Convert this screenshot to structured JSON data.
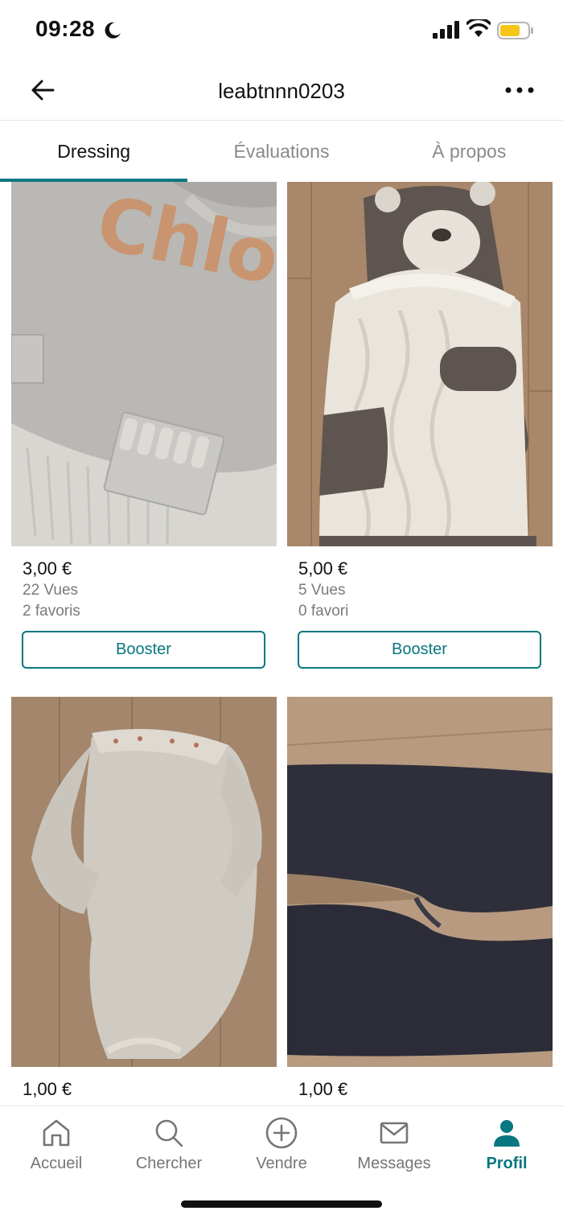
{
  "status": {
    "time": "09:28"
  },
  "header": {
    "title": "leabtnnn0203"
  },
  "tabs": [
    {
      "label": "Dressing"
    },
    {
      "label": "Évaluations"
    },
    {
      "label": "À propos"
    }
  ],
  "items": [
    {
      "photo": "grey-knit-sweater",
      "price": "3,00 €",
      "views": "22 Vues",
      "favorites": "2 favoris",
      "booster_label": "Booster"
    },
    {
      "photo": "bear-knit-sleeping-bag",
      "price": "5,00 €",
      "views": "5 Vues",
      "favorites": "0 favori",
      "booster_label": "Booster"
    },
    {
      "photo": "grey-bodysuit",
      "price": "1,00 €"
    },
    {
      "photo": "dark-leggings",
      "price": "1,00 €"
    }
  ],
  "bottom_nav": [
    {
      "label": "Accueil",
      "icon": "home-icon"
    },
    {
      "label": "Chercher",
      "icon": "search-icon"
    },
    {
      "label": "Vendre",
      "icon": "plus-circle-icon"
    },
    {
      "label": "Messages",
      "icon": "mail-icon"
    },
    {
      "label": "Profil",
      "icon": "profile-icon"
    }
  ],
  "colors": {
    "accent": "#09777f",
    "muted": "#7a7a7a"
  }
}
